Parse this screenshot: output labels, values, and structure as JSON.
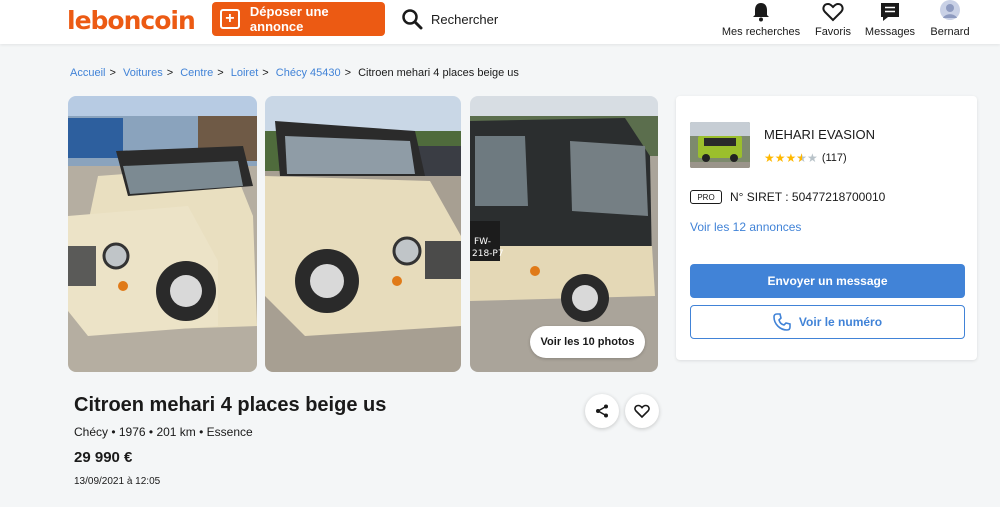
{
  "header": {
    "logo": "leboncoin",
    "post_button": "Déposer une annonce",
    "search_label": "Rechercher",
    "nav": [
      {
        "label": "Mes recherches",
        "icon": "bell-icon"
      },
      {
        "label": "Favoris",
        "icon": "heart-icon"
      },
      {
        "label": "Messages",
        "icon": "message-icon"
      },
      {
        "label": "Bernard",
        "icon": "avatar-icon"
      }
    ]
  },
  "breadcrumb": {
    "items": [
      "Accueil",
      "Voitures",
      "Centre",
      "Loiret",
      "Chécy 45430"
    ],
    "current": "Citroen mehari 4 places beige us"
  },
  "gallery": {
    "see_photos": "Voir les 10 photos"
  },
  "listing": {
    "title": "Citroen mehari 4 places beige us",
    "subtitle": "Chécy • 1976 • 201 km • Essence",
    "price": "29 990 €",
    "date": "13/09/2021 à 12:05"
  },
  "seller": {
    "name": "MEHARI EVASION",
    "rating_count": "(117)",
    "rating_value": 3.5,
    "pro_badge": "PRO",
    "siret": "N° SIRET : 50477218700010",
    "see_ads": "Voir les 12 annonces",
    "message_button": "Envoyer un message",
    "phone_button": "Voir le numéro"
  },
  "colors": {
    "brand": "#ec5a13",
    "link": "#4183d7",
    "background": "#f4f6f7",
    "star": "#ffb800"
  }
}
